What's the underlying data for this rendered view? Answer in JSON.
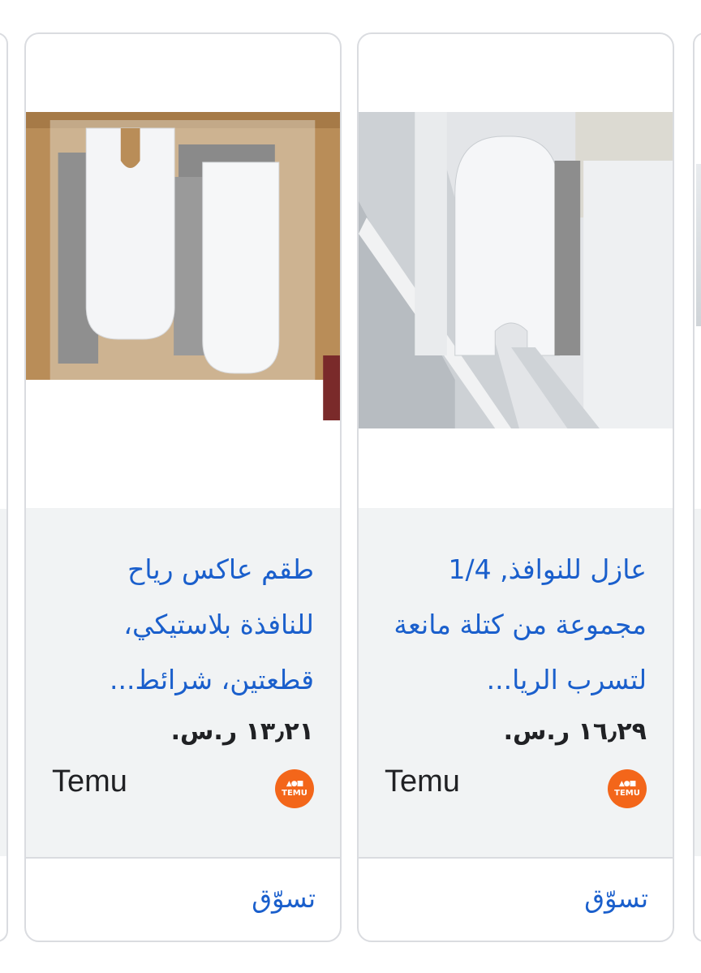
{
  "products": [
    {
      "title": "طقم عاكس رياح للنافذة بلاستيكي، قطعتين، شرائط...",
      "price": "١٣٫٢١ ر.س.",
      "merchant": "Temu",
      "logo_text": "TEMU",
      "shop_label": "تسوّق"
    },
    {
      "title": "عازل للنوافذ, 1/4 مجموعة من كتلة مانعة لتسرب الريا...",
      "price": "١٦٫٢٩ ر.س.",
      "merchant": "Temu",
      "logo_text": "TEMU",
      "shop_label": "تسوّق"
    }
  ],
  "colors": {
    "link": "#1a5fcc",
    "info_bg": "#f1f3f4",
    "border": "#dadce0",
    "temu_orange": "#f3661a"
  }
}
